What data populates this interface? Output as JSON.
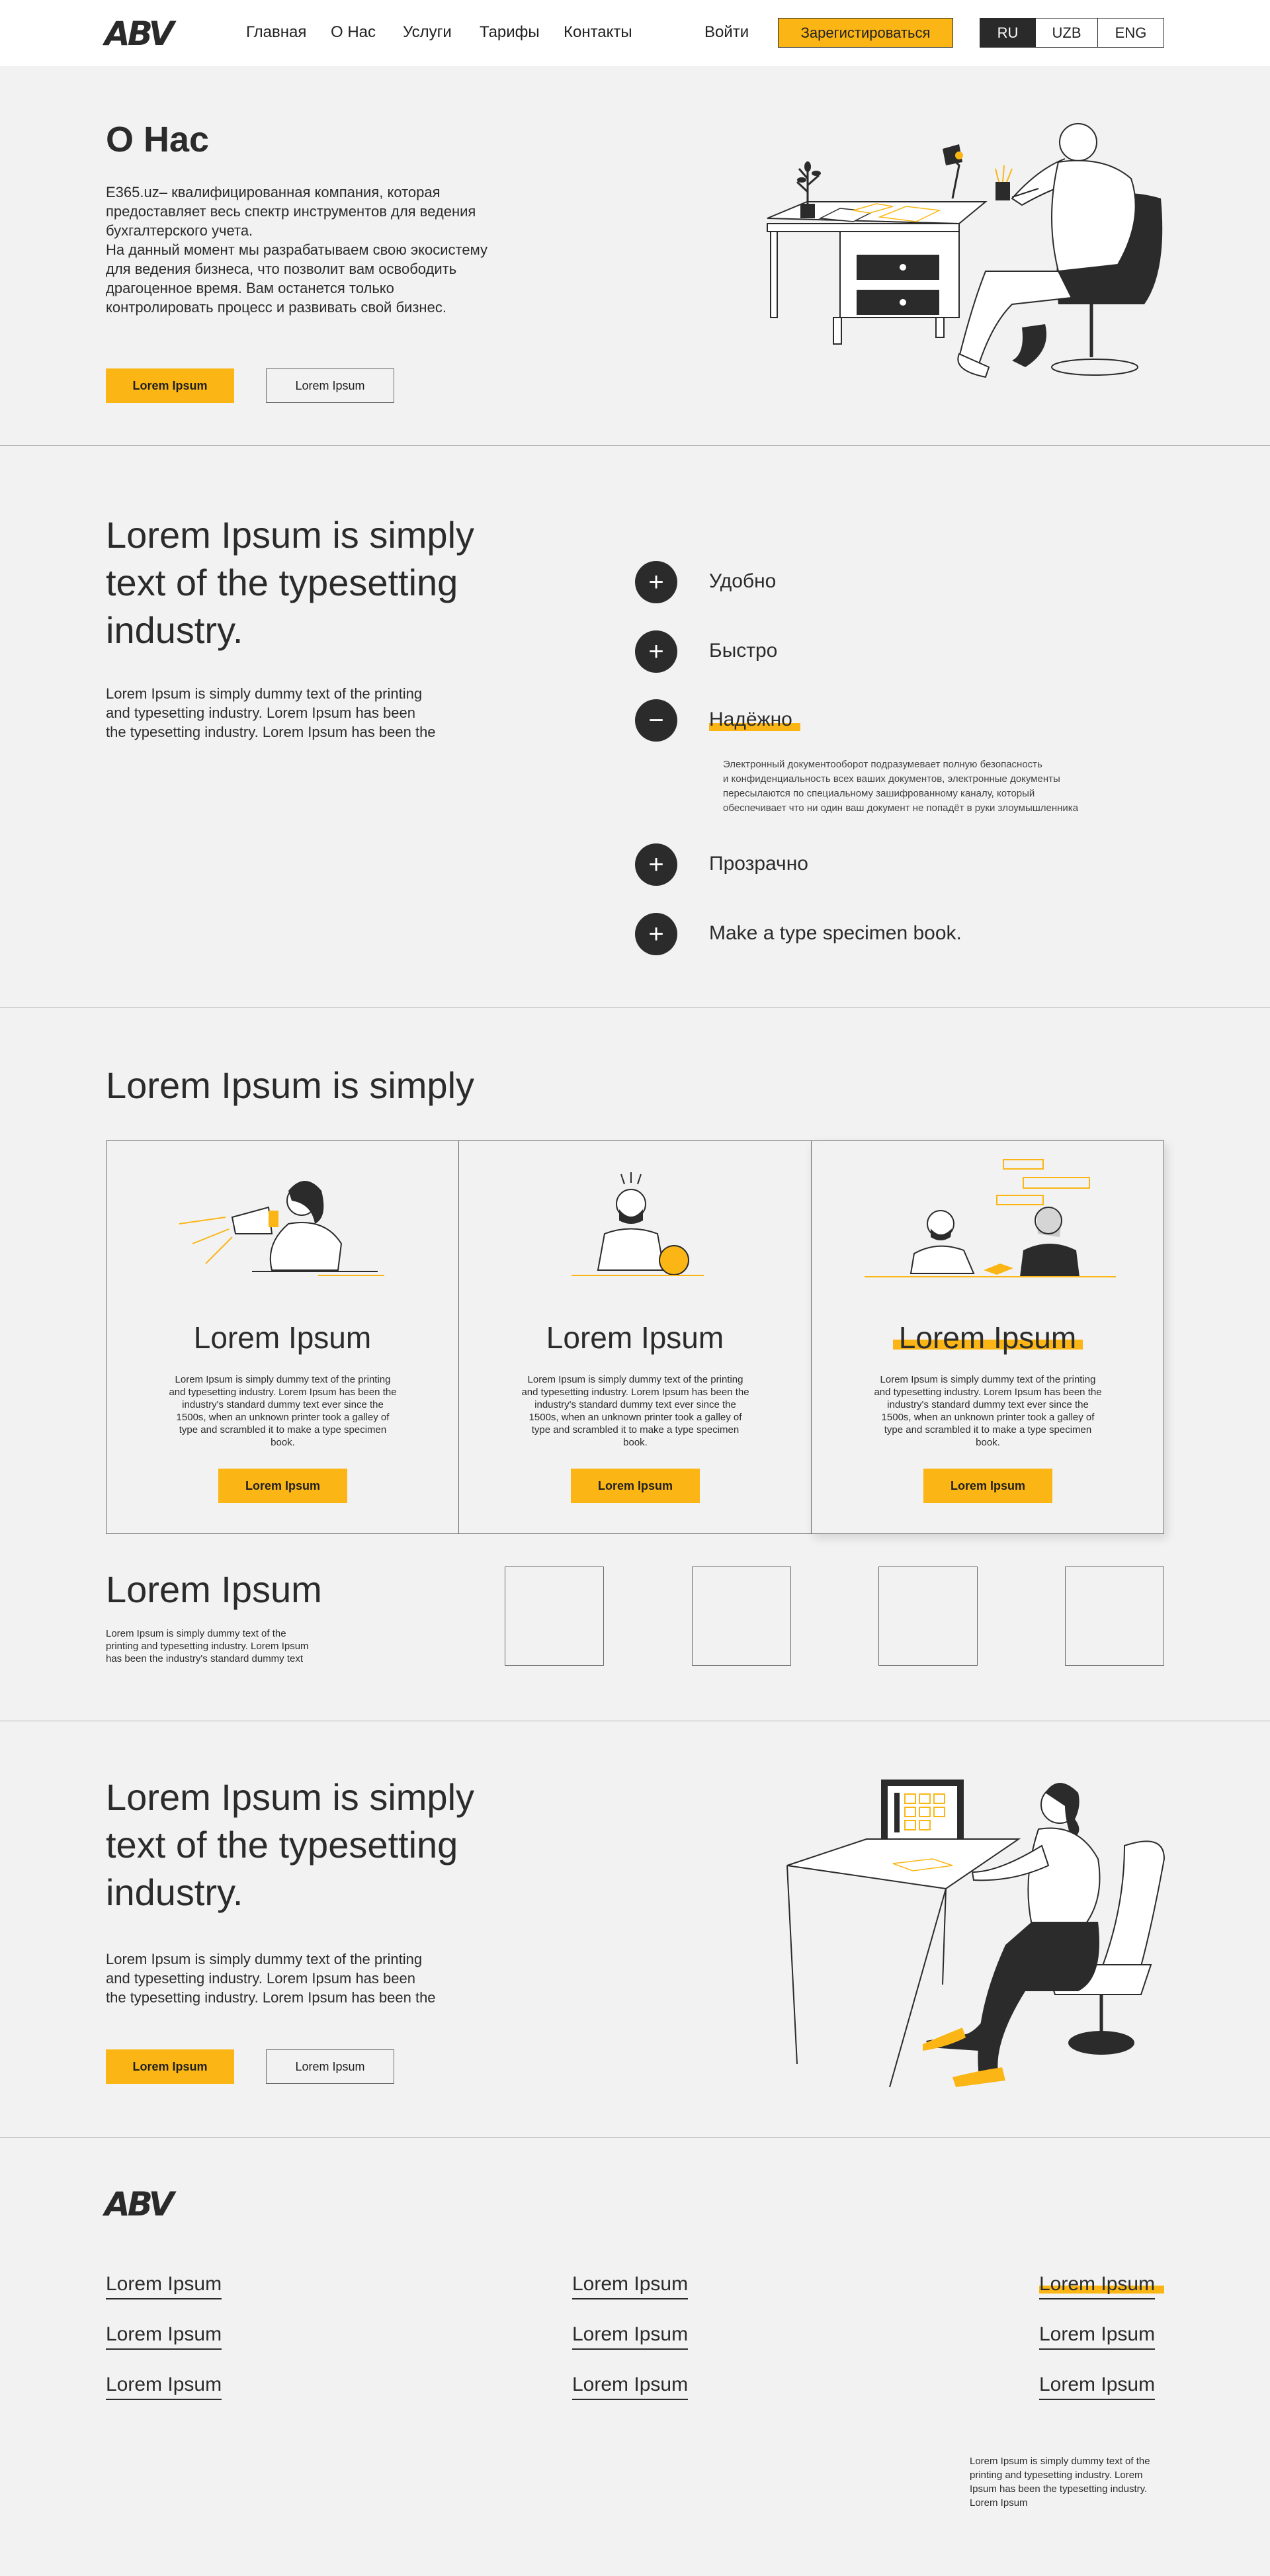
{
  "header": {
    "logo": "ABV",
    "nav": [
      "Главная",
      "О Нас",
      "Услуги",
      "Тарифы",
      "Контакты"
    ],
    "login": "Войти",
    "register": "Зарегистироваться",
    "languages": [
      "RU",
      "UZB",
      "ENG"
    ],
    "active_language": "RU"
  },
  "about": {
    "title": "О Нас",
    "text": "E365.uz– квалифицированная компания, которая\nпредоставляет весь спектр инструментов для ведения\nбухгалтерского учета.\nНа данный момент мы разрабатываем свою экосистему\nдля ведения бизнеса, что позволит вам освободить\nдрагоценное время. Вам останется только\nконтролировать процесс и развивать свой бизнес.",
    "primary_button": "Lorem Ipsum",
    "secondary_button": "Lorem Ipsum"
  },
  "features": {
    "title": "Lorem Ipsum is simply\ntext of the  typesetting\nindustry.",
    "text": "Lorem Ipsum is simply dummy text of the printing\nand typesetting industry. Lorem Ipsum has been\nthe typesetting industry. Lorem Ipsum has been the",
    "items": [
      {
        "label": "Удобно",
        "icon": "plus"
      },
      {
        "label": "Быстро",
        "icon": "plus"
      },
      {
        "label": "Надёжно",
        "icon": "minus",
        "description": "Электронный документооборот подразумевает полную безопасность\nи конфиденциальность всех ваших документов, электронные документы\nпересылаются по специальному зашифрованному каналу, который\nобеспечивает что ни один ваш документ не попадёт в руки злоумышленника"
      },
      {
        "label": "Прозрачно",
        "icon": "plus"
      },
      {
        "label": "Make a type specimen book.",
        "icon": "plus"
      }
    ]
  },
  "services": {
    "title": "Lorem Ipsum is simply",
    "cards": [
      {
        "title": "Lorem Ipsum",
        "text": "Lorem Ipsum is simply dummy text of the printing and typesetting industry. Lorem Ipsum has been the industry's standard dummy text ever since the 1500s, when an unknown printer took a galley of type and scrambled it to make a type specimen book.",
        "button": "Lorem Ipsum"
      },
      {
        "title": "Lorem Ipsum",
        "text": "Lorem Ipsum is simply dummy text of the printing and typesetting industry. Lorem Ipsum has been the industry's standard dummy text ever since the 1500s, when an unknown printer took a galley of type and scrambled it to make a type specimen book.",
        "button": "Lorem Ipsum"
      },
      {
        "title": "Lorem Ipsum",
        "text": "Lorem Ipsum is simply dummy text of the printing and typesetting industry. Lorem Ipsum has been the industry's standard dummy text ever since the 1500s, when an unknown printer took a galley of type and scrambled it to make a type specimen book.",
        "button": "Lorem Ipsum"
      }
    ]
  },
  "partners": {
    "title": "Lorem Ipsum",
    "text": "Lorem Ipsum is simply dummy text of the\nprinting and typesetting industry. Lorem Ipsum\nhas been the industry's standard dummy text"
  },
  "cta": {
    "title": "Lorem Ipsum is simply\ntext of the  typesetting\nindustry.",
    "text": "Lorem Ipsum is simply dummy text of the printing\nand typesetting industry. Lorem Ipsum has been\nthe typesetting industry. Lorem Ipsum has been the",
    "primary_button": "Lorem Ipsum",
    "secondary_button": "Lorem Ipsum"
  },
  "footer": {
    "logo": "ABV",
    "columns": [
      [
        "Lorem Ipsum",
        "Lorem Ipsum",
        "Lorem Ipsum"
      ],
      [
        "Lorem Ipsum",
        "Lorem Ipsum",
        "Lorem Ipsum"
      ],
      [
        "Lorem Ipsum",
        "Lorem Ipsum",
        "Lorem Ipsum"
      ]
    ],
    "text": "Lorem Ipsum is simply dummy text of the\nprinting and typesetting industry. Lorem\nIpsum has been the typesetting industry.\nLorem Ipsum"
  },
  "colors": {
    "accent": "#fbb615",
    "dark": "#2b2b2b",
    "background": "#f2f2f2"
  }
}
